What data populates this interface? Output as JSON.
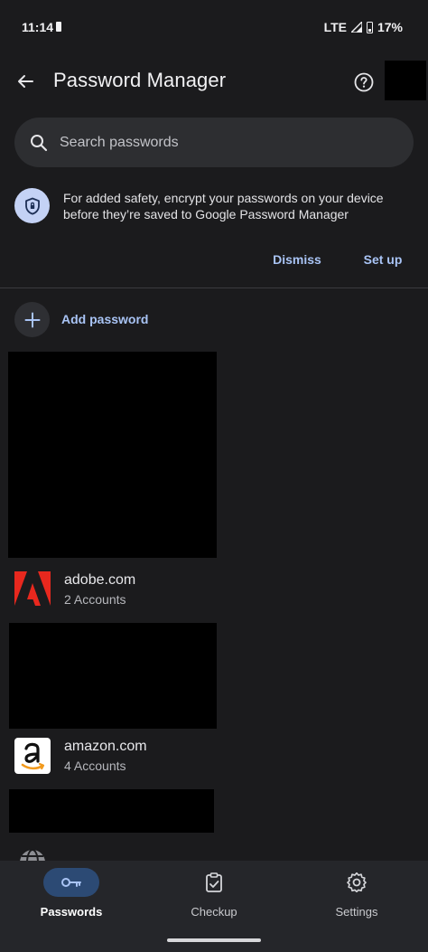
{
  "status_bar": {
    "time": "11:14",
    "network": "LTE",
    "battery": "17%"
  },
  "app_bar": {
    "title": "Password Manager"
  },
  "search": {
    "placeholder": "Search passwords"
  },
  "banner": {
    "text": "For added safety, encrypt your passwords on your device before they’re saved to Google Password Manager",
    "dismiss_label": "Dismiss",
    "setup_label": "Set up"
  },
  "add_password": {
    "label": "Add password"
  },
  "passwords": [
    {
      "site": "adobe.com",
      "accounts": "2 Accounts",
      "icon": "adobe-logo"
    },
    {
      "site": "amazon.com",
      "accounts": "4 Accounts",
      "icon": "amazon-logo"
    }
  ],
  "bottom_nav": [
    {
      "label": "Passwords",
      "icon": "key-icon",
      "active": true
    },
    {
      "label": "Checkup",
      "icon": "clipboard-check-icon",
      "active": false
    },
    {
      "label": "Settings",
      "icon": "gear-icon",
      "active": false
    }
  ],
  "colors": {
    "accent": "#a9c4f5",
    "background": "#1b1b1d",
    "active_pill": "#2c4a74"
  }
}
